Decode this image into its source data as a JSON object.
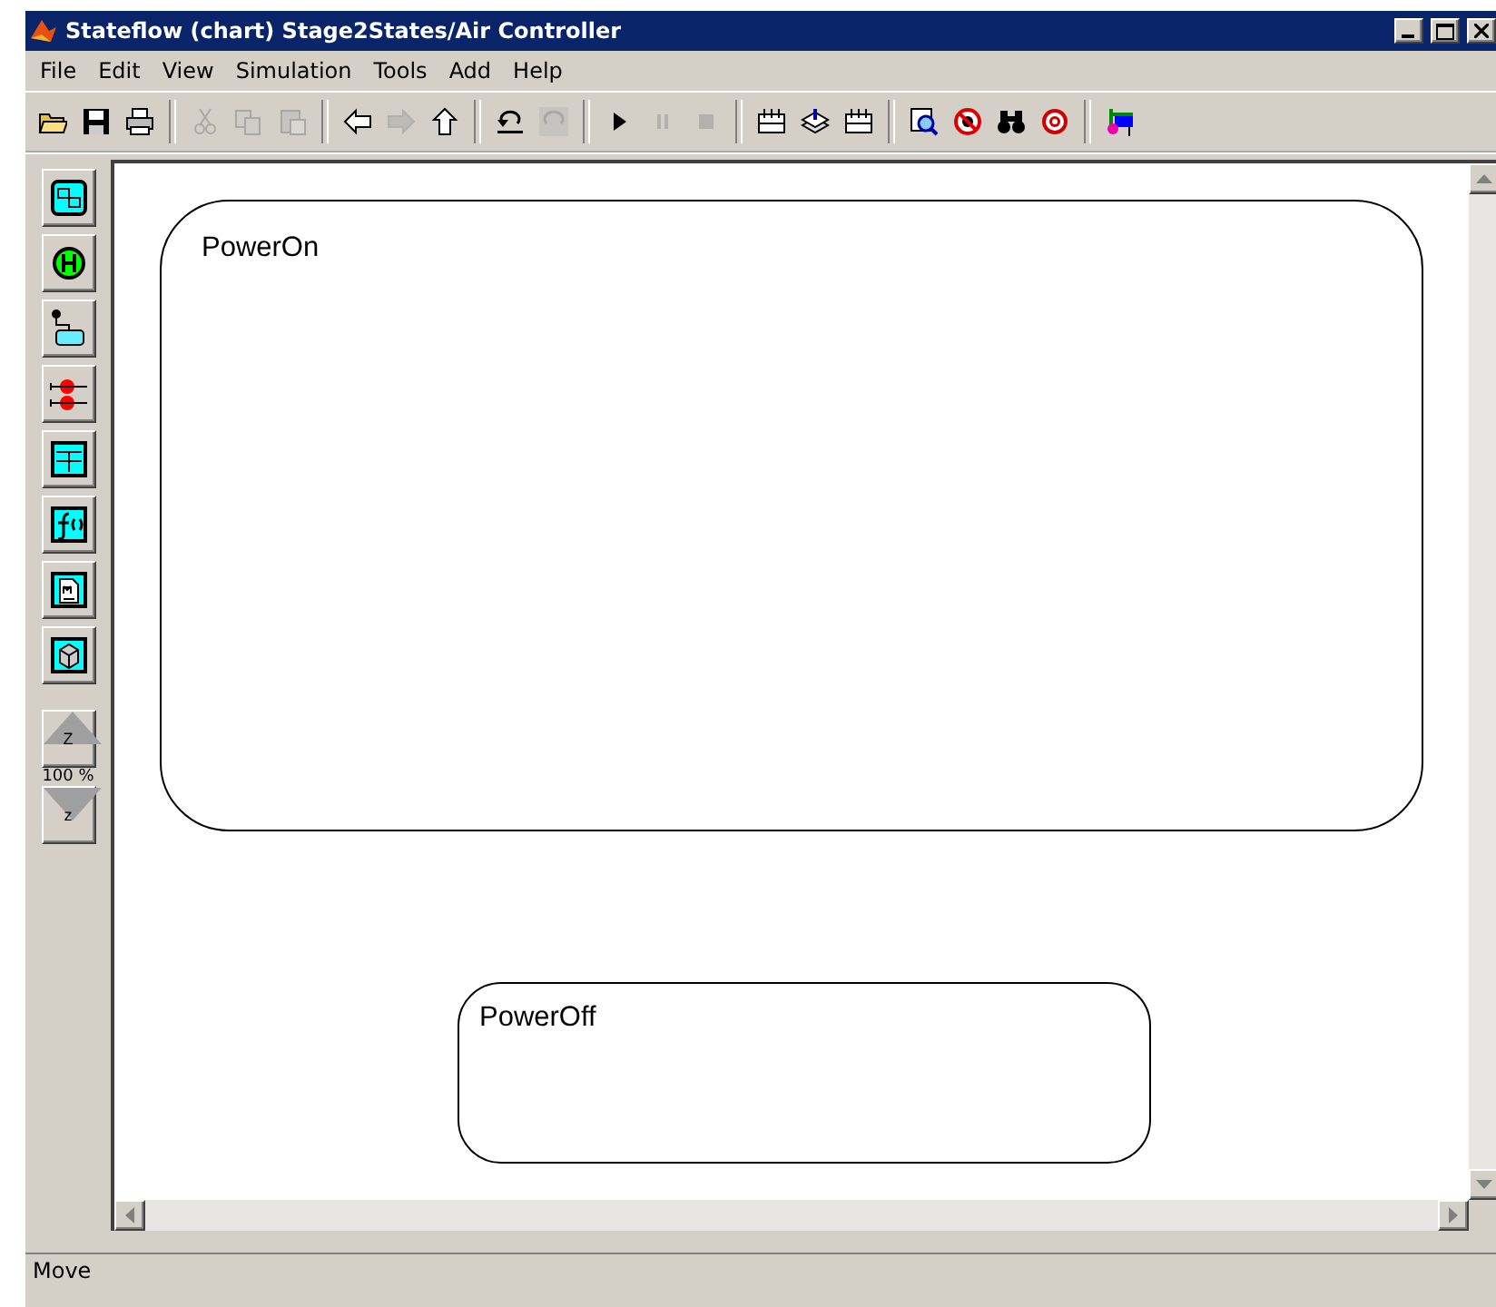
{
  "window": {
    "title": "Stateflow (chart) Stage2States/Air Controller"
  },
  "menu": [
    {
      "label": "File"
    },
    {
      "label": "Edit"
    },
    {
      "label": "View"
    },
    {
      "label": "Simulation"
    },
    {
      "label": "Tools"
    },
    {
      "label": "Add"
    },
    {
      "label": "Help"
    }
  ],
  "toolbar": [
    {
      "kind": "open",
      "disabled": false
    },
    {
      "kind": "save",
      "disabled": false
    },
    {
      "kind": "print",
      "disabled": false
    },
    {
      "kind": "sep"
    },
    {
      "kind": "cut",
      "disabled": true
    },
    {
      "kind": "copy",
      "disabled": true
    },
    {
      "kind": "paste",
      "disabled": true
    },
    {
      "kind": "sep"
    },
    {
      "kind": "back",
      "disabled": false
    },
    {
      "kind": "forward",
      "disabled": true
    },
    {
      "kind": "up",
      "disabled": false
    },
    {
      "kind": "sep"
    },
    {
      "kind": "undo",
      "disabled": false
    },
    {
      "kind": "redo",
      "disabled": true
    },
    {
      "kind": "sep"
    },
    {
      "kind": "play",
      "disabled": false
    },
    {
      "kind": "pause",
      "disabled": true
    },
    {
      "kind": "stop",
      "disabled": true
    },
    {
      "kind": "sep"
    },
    {
      "kind": "grid",
      "disabled": false
    },
    {
      "kind": "stack",
      "disabled": false
    },
    {
      "kind": "grid",
      "disabled": false
    },
    {
      "kind": "sep"
    },
    {
      "kind": "zoom",
      "disabled": false
    },
    {
      "kind": "nobug",
      "disabled": false
    },
    {
      "kind": "binoculars",
      "disabled": false
    },
    {
      "kind": "target",
      "disabled": false
    },
    {
      "kind": "sep"
    },
    {
      "kind": "explorer",
      "disabled": false
    }
  ],
  "palette": [
    {
      "kind": "state"
    },
    {
      "kind": "history"
    },
    {
      "kind": "default"
    },
    {
      "kind": "junction"
    },
    {
      "kind": "table"
    },
    {
      "kind": "function"
    },
    {
      "kind": "document"
    },
    {
      "kind": "box"
    }
  ],
  "zoom": {
    "in_label": "Z",
    "level": "100 %",
    "out_label": "z"
  },
  "states": [
    {
      "name": "PowerOn"
    },
    {
      "name": "PowerOff"
    }
  ],
  "status_bar": "Move"
}
